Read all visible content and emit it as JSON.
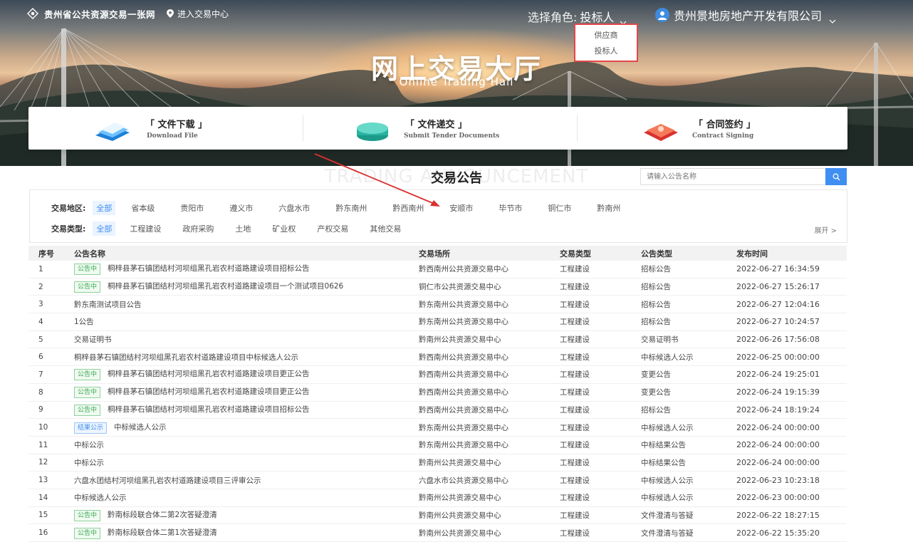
{
  "topbar": {
    "site_title": "贵州省公共资源交易一张网",
    "enter_link": "进入交易中心",
    "role_label": "选择角色:",
    "role_value": "投标人",
    "company": "贵州景地房地产开发有限公司"
  },
  "role_dropdown": {
    "options": [
      "供应商",
      "投标人"
    ]
  },
  "hero": {
    "title": "网上交易大厅",
    "subtitle": "Online Trading Hall"
  },
  "functions": [
    {
      "title": "「 文件下载 」",
      "subtitle": "Download File",
      "icon": "download-file-icon"
    },
    {
      "title": "「 文件递交 」",
      "subtitle": "Submit Tender Documents",
      "icon": "submit-documents-icon"
    },
    {
      "title": "「 合同签约 」",
      "subtitle": "Contract Signing",
      "icon": "contract-signing-icon"
    }
  ],
  "section": {
    "bg_text": "TRADING ANNOUNCEMENT",
    "title": "交易公告",
    "search_placeholder": "请输入公告名称"
  },
  "filters": {
    "region_label": "交易地区:",
    "regions": [
      "全部",
      "省本级",
      "贵阳市",
      "遵义市",
      "六盘水市",
      "黔东南州",
      "黔西南州",
      "安顺市",
      "毕节市",
      "铜仁市",
      "黔南州"
    ],
    "type_label": "交易类型:",
    "types": [
      "全部",
      "工程建设",
      "政府采购",
      "土地",
      "矿业权",
      "产权交易",
      "其他交易"
    ],
    "expand": "展开 >"
  },
  "table": {
    "headers": [
      "序号",
      "公告名称",
      "交易场所",
      "交易类型",
      "公告类型",
      "发布时间"
    ],
    "rows": [
      {
        "no": "1",
        "tag": "公告中",
        "tag_color": "green",
        "name": "桐梓县茅石镇团结村河坝组黑孔岩农村道路建设项目招标公告",
        "venue": "黔西南州公共资源交易中心",
        "type": "工程建设",
        "atype": "招标公告",
        "time": "2022-06-27 16:34:59"
      },
      {
        "no": "2",
        "tag": "公告中",
        "tag_color": "green",
        "name": "桐梓县茅石镇团结村河坝组黑孔岩农村道路建设项目一个测试项目0626",
        "venue": "铜仁市公共资源交易中心",
        "type": "工程建设",
        "atype": "招标公告",
        "time": "2022-06-27 15:26:17"
      },
      {
        "no": "3",
        "tag": "",
        "tag_color": "",
        "name": "黔东南测试项目公告",
        "venue": "黔东南州公共资源交易中心",
        "type": "工程建设",
        "atype": "招标公告",
        "time": "2022-06-27 12:04:16"
      },
      {
        "no": "4",
        "tag": "",
        "tag_color": "",
        "name": "1公告",
        "venue": "黔东南州公共资源交易中心",
        "type": "工程建设",
        "atype": "招标公告",
        "time": "2022-06-27 10:24:57"
      },
      {
        "no": "5",
        "tag": "",
        "tag_color": "",
        "name": "交易证明书",
        "venue": "黔南州公共资源交易中心",
        "type": "工程建设",
        "atype": "交易证明书",
        "time": "2022-06-26 17:56:08"
      },
      {
        "no": "6",
        "tag": "",
        "tag_color": "",
        "name": "桐梓县茅石镇团结村河坝组黑孔岩农村道路建设项目中标候选人公示",
        "venue": "黔西南州公共资源交易中心",
        "type": "工程建设",
        "atype": "中标候选人公示",
        "time": "2022-06-25 00:00:00"
      },
      {
        "no": "7",
        "tag": "公告中",
        "tag_color": "green",
        "name": "桐梓县茅石镇团结村河坝组黑孔岩农村道路建设项目更正公告",
        "venue": "黔西南州公共资源交易中心",
        "type": "工程建设",
        "atype": "变更公告",
        "time": "2022-06-24 19:25:01"
      },
      {
        "no": "8",
        "tag": "公告中",
        "tag_color": "green",
        "name": "桐梓县茅石镇团结村河坝组黑孔岩农村道路建设项目更正公告",
        "venue": "黔西南州公共资源交易中心",
        "type": "工程建设",
        "atype": "变更公告",
        "time": "2022-06-24 19:15:39"
      },
      {
        "no": "9",
        "tag": "公告中",
        "tag_color": "green",
        "name": "桐梓县茅石镇团结村河坝组黑孔岩农村道路建设项目招标公告",
        "venue": "黔西南州公共资源交易中心",
        "type": "工程建设",
        "atype": "招标公告",
        "time": "2022-06-24 18:19:24"
      },
      {
        "no": "10",
        "tag": "结果公示",
        "tag_color": "blue",
        "name": "中标候选人公示",
        "venue": "黔东南州公共资源交易中心",
        "type": "工程建设",
        "atype": "中标候选人公示",
        "time": "2022-06-24 00:00:00"
      },
      {
        "no": "11",
        "tag": "",
        "tag_color": "",
        "name": "中标公示",
        "venue": "黔东南州公共资源交易中心",
        "type": "工程建设",
        "atype": "中标结果公告",
        "time": "2022-06-24 00:00:00"
      },
      {
        "no": "12",
        "tag": "",
        "tag_color": "",
        "name": "中标公示",
        "venue": "黔南州公共资源交易中心",
        "type": "工程建设",
        "atype": "中标结果公告",
        "time": "2022-06-24 00:00:00"
      },
      {
        "no": "13",
        "tag": "",
        "tag_color": "",
        "name": "六盘水团结村河坝组黑孔岩农村道路建设项目三评审公示",
        "venue": "六盘水市公共资源交易中心",
        "type": "工程建设",
        "atype": "中标候选人公示",
        "time": "2022-06-23 10:23:18"
      },
      {
        "no": "14",
        "tag": "",
        "tag_color": "",
        "name": "中标候选人公示",
        "venue": "黔南州公共资源交易中心",
        "type": "工程建设",
        "atype": "中标候选人公示",
        "time": "2022-06-23 00:00:00"
      },
      {
        "no": "15",
        "tag": "公告中",
        "tag_color": "green",
        "name": "黔南标段联合体二第2次答疑澄清",
        "venue": "黔南州公共资源交易中心",
        "type": "工程建设",
        "atype": "文件澄清与答疑",
        "time": "2022-06-22 18:27:15"
      },
      {
        "no": "16",
        "tag": "公告中",
        "tag_color": "green",
        "name": "黔南标段联合体二第1次答疑澄清",
        "venue": "黔南州公共资源交易中心",
        "type": "工程建设",
        "atype": "文件澄清与答疑",
        "time": "2022-06-22 15:35:20"
      }
    ]
  },
  "colors": {
    "accent": "#3f8ef1",
    "tag_green": "#3aa84f",
    "highlight_red": "#e2474a"
  }
}
